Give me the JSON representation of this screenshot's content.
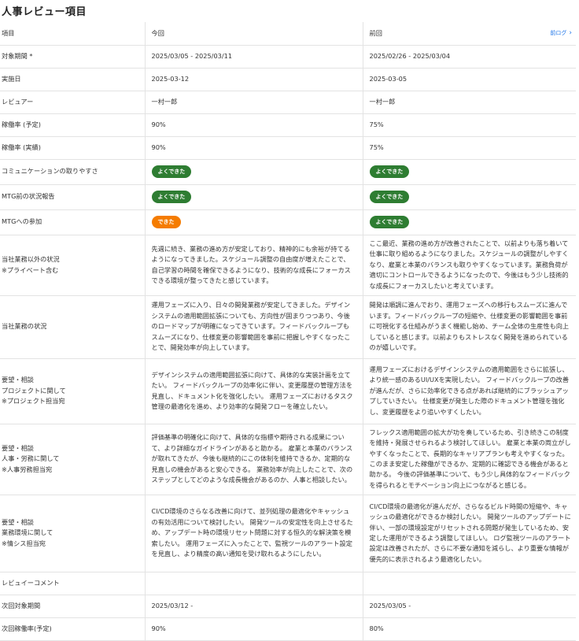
{
  "page_title": "人事レビュー項目",
  "header": {
    "item": "項目",
    "current": "今回",
    "previous": "前回",
    "log_link": "前ログ",
    "log_icon": "chevron-right-icon"
  },
  "badge_colors": {
    "よくできた": "#2e7d32",
    "できた": "#f57c00"
  },
  "rows": [
    {
      "label": "対象期間 *",
      "current": "2025/03/05 - 2025/03/11",
      "previous": "2025/02/26 - 2025/03/04"
    },
    {
      "label": "実施日",
      "current": "2025-03-12",
      "previous": "2025-03-05"
    },
    {
      "label": "レビュアー",
      "current": "一村一郎",
      "previous": "一村一郎"
    },
    {
      "label": "稼働率 (予定)",
      "current": "90%",
      "previous": "75%"
    },
    {
      "label": "稼働率 (実績)",
      "current": "90%",
      "previous": "75%"
    },
    {
      "label": "コミュニケーションの取りやすさ",
      "current": "よくできた",
      "previous": "よくできた"
    },
    {
      "label": "MTG前の状況報告",
      "current": "よくできた",
      "previous": "よくできた"
    },
    {
      "label": "MTGへの参加",
      "current": "できた",
      "previous": "よくできた"
    },
    {
      "label": "当社業務以外の状況\n※プライベート含む",
      "current": "先週に続き、業務の進め方が安定しており、精神的にも余裕が持てるようになってきました。スケジュール調整の自由度が増えたことで、自己学習の時間を確保できるようになり、技術的な成長にフォーカスできる環境が整ってきたと感じています。",
      "previous": "ここ最近、業務の進め方が改善されたことで、以前よりも落ち着いて仕事に取り組めるようになりました。スケジュールの調整がしやすくなり、雇業と本業のバランスも取りやすくなっています。業務負荷が適切にコントロールできるようになったので、今後はもう少し技術的な成長にフォーカスしたいと考えています。"
    },
    {
      "label": "当社業務の状況",
      "current": "運用フェーズに入り、日々の開発業務が安定してきました。デザインシステムの適用範囲拡張についても、方向性が固まりつつあり、今後のロードマップが明確になってきています。フィードバックループもスムーズになり、仕様変更の影響範囲を事前に把握しやすくなったことで、開発効率が向上しています。",
      "previous": "開発は順調に進んでおり、運用フェーズへの移行もスムーズに進んでいます。フィードバックループの短縮や、仕様変更の影響範囲を事前に可視化する仕組みがうまく機能し始め、チーム全体の生産性も向上していると感じます。以前よりもストレスなく開発を進められているのが嬉しいです。"
    },
    {
      "label": "要望・相談\nプロジェクトに関して\n※プロジェクト担当宛",
      "current": "デザインシステムの適用範囲拡張に向けて、具体的な実装計画を立てたい。 フィードバックループの効率化に伴い、変更履歴の管理方法を見直し、ドキュメント化を強化したい。 運用フェーズにおけるタスク管理の最適化を進め、より効率的な開発フローを確立したい。",
      "previous": "運用フェーズにおけるデザインシステムの適用範囲をさらに拡張し、より統一感のあるUI/UXを実現したい。 フィードバックループの改善が進んだが、さらに効率化できる点があれば継続的にブラッシュアップしていきたい。 仕様変更が発生した際のドキュメント管理を強化し、変更履歴をより追いやすくしたい。"
    },
    {
      "label": "要望・相談\n人事・労務に関して\n※人事労務担当宛",
      "current": "評価基準の明確化に向けて、具体的な指標や期待される成果について、より詳細なガイドラインがあると助かる。 雇業と本業のバランスが取れてきたが、今後も継続的にこの体制を維持できるか、定期的な見直しの機会があると安心できる。 業務効率が向上したことで、次のステップとしてどのような成長機会があるのか、人事と相談したい。",
      "previous": "フレックス適用範囲の拡大が功を奏しているため、引き続きこの制度を維持・発展させられるよう検討してほしい。 雇業と本業の両立がしやすくなったことで、長期的なキャリアプランも考えやすくなった。このまま安定した稼働ができるか、定期的に確認できる機会があると助かる。 今後の評価基準について、もう少し具体的なフィードバックを得られるとモチベーション向上につながると感じる。"
    },
    {
      "label": "要望・相談\n業務環境に関して\n※情シス担当宛",
      "current": "CI/CD環境のさらなる改善に向けて、並列処理の最適化やキャッシュの有効活用について検討したい。 開発ツールの安定性を向上させるため、アップデート時の環境リセット問題に対する恒久的な解決策を模索したい。 運用フェーズに入ったことで、監視ツールのアラート設定を見直し、より精度の高い通知を受け取れるようにしたい。",
      "previous": "CI/CD環境の最適化が進んだが、さらなるビルド時間の短縮や、キャッシュの最適化ができるか検討したい。 開発ツールのアップデートに伴い、一部の環境設定がリセットされる問題が発生しているため、安定した運用ができるよう調整してほしい。 ログ監視ツールのアラート設定は改善されたが、さらに不要な通知を減らし、より重要な情報が優先的に表示されるよう最適化したい。"
    },
    {
      "label": "レビュイーコメント",
      "current": "",
      "previous": ""
    },
    {
      "label": "次回対象期間",
      "current": "2025/03/12 -",
      "previous": "2025/03/05 -"
    },
    {
      "label": "次回稼働率(予定)",
      "current": "90%",
      "previous": "80%"
    }
  ]
}
